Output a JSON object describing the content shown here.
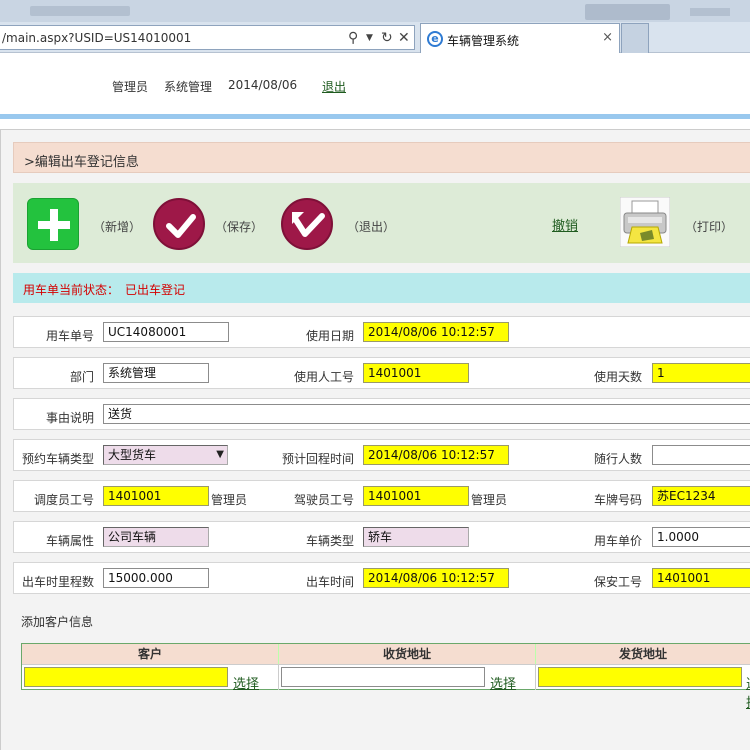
{
  "browser": {
    "address": "/main.aspx?USID=US14010001",
    "tab_title": "车辆管理系统",
    "tab_close": "×"
  },
  "header": {
    "user": "管理员",
    "dept": "系统管理",
    "date": "2014/08/06",
    "logout": "退出"
  },
  "page_title": ">编辑出车登记信息",
  "toolbar": {
    "add_label": "（新增）",
    "save_label": "（保存）",
    "exit_label": "（退出）",
    "undo_label": "撤销",
    "print_label": "（打印）"
  },
  "status": {
    "label": "用车单当前状态：",
    "value": "已出车登记"
  },
  "form": {
    "order_no_label": "用车单号",
    "order_no": "UC14080001",
    "use_date_label": "使用日期",
    "use_date": "2014/08/06 10:12:57",
    "dept_label": "部门",
    "dept": "系统管理",
    "user_id_label": "使用人工号",
    "user_id": "1401001",
    "days_label": "使用天数",
    "days": "1",
    "reason_label": "事由说明",
    "reason": "送货",
    "vehicle_type_req_label": "预约车辆类型",
    "vehicle_type_req": "大型货车",
    "return_time_label": "预计回程时间",
    "return_time": "2014/08/06 10:12:57",
    "companions_label": "随行人数",
    "companions": "",
    "dispatcher_label": "调度员工号",
    "dispatcher": "1401001",
    "dispatcher_name": "管理员",
    "driver_label": "驾驶员工号",
    "driver": "1401001",
    "driver_name": "管理员",
    "plate_label": "车牌号码",
    "plate": "苏EC1234",
    "property_label": "车辆属性",
    "property": "公司车辆",
    "vehicle_type_label": "车辆类型",
    "vehicle_type": "轿车",
    "unit_price_label": "用车单价",
    "unit_price": "1.0000",
    "mileage_label": "出车时里程数",
    "mileage": "15000.000",
    "depart_time_label": "出车时间",
    "depart_time": "2014/08/06 10:12:57",
    "guard_label": "保安工号",
    "guard": "1401001"
  },
  "customer": {
    "section_label": "添加客户信息",
    "col_customer": "客户",
    "col_receive": "收货地址",
    "col_ship": "发货地址",
    "select": "选择"
  },
  "colors": {
    "highlight": "#ffff00",
    "readonly": "#eedcea",
    "status": "#d40000",
    "toolbar_bg": "#ddebd7",
    "title_bg": "#f5ddd0",
    "status_bg": "#b8eaec"
  }
}
